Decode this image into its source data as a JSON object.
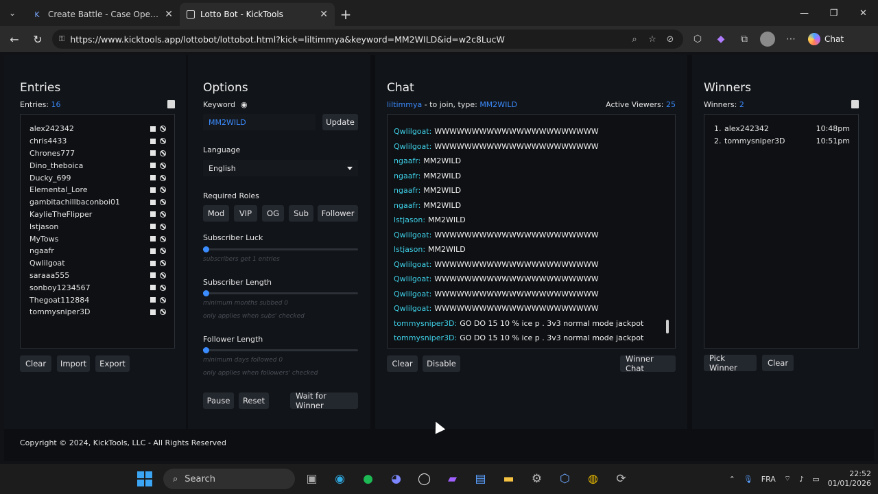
{
  "browser": {
    "tabs": [
      {
        "title": "Create Battle - Case Opening Battle",
        "active": false,
        "icon": "kick-icon"
      },
      {
        "title": "Lotto Bot - KickTools",
        "active": true,
        "icon": "kicktools-icon"
      }
    ],
    "url": "https://www.kicktools.app/lottobot/lottobot.html?kick=liltimmya&keyword=MM2WILD&id=w2c8LucW",
    "copilot_label": "Chat"
  },
  "entries": {
    "title": "Entries",
    "count_label": "Entries:",
    "count": "16",
    "items": [
      "alex242342",
      "chris4433",
      "Chrones777",
      "Dino_theboica",
      "Ducky_699",
      "Elemental_Lore",
      "gambitachillbaconboi01",
      "KaylieTheFlipper",
      "lstjason",
      "MyTows",
      "ngaafr",
      "Qwlilgoat",
      "saraaa555",
      "sonboy1234567",
      "Thegoat112884",
      "tommysniper3D"
    ],
    "buttons": {
      "clear": "Clear",
      "import": "Import",
      "export": "Export"
    }
  },
  "options": {
    "title": "Options",
    "keyword_label": "Keyword",
    "keyword_value": "MM2WILD",
    "update_label": "Update",
    "language_label": "Language",
    "language_value": "English",
    "roles_label": "Required Roles",
    "roles": [
      "Mod",
      "VIP",
      "OG",
      "Sub",
      "Follower"
    ],
    "sub_luck_label": "Subscriber Luck",
    "sub_luck_hint": "subscribers get 1 entries",
    "sub_length_label": "Subscriber Length",
    "sub_length_hint1": "minimum months subbed 0",
    "sub_length_hint2": "only applies when subs' checked",
    "follower_length_label": "Follower Length",
    "follower_length_hint1": "minimum days followed 0",
    "follower_length_hint2": "only applies when followers' checked",
    "pause_label": "Pause",
    "reset_label": "Reset",
    "wait_label": "Wait for Winner"
  },
  "chat": {
    "title": "Chat",
    "channel": "liltimmya",
    "join_text": "- to join, type:",
    "keyword": "MM2WILD",
    "viewers_label": "Active Viewers:",
    "viewers": "25",
    "messages": [
      {
        "user": "Qwlilgoat:",
        "text": "WWWWWWWWWWWWWWWWWWWWWW"
      },
      {
        "user": "Qwlilgoat:",
        "text": "WWWWWWWWWWWWWWWWWWWWWW"
      },
      {
        "user": "ngaafr:",
        "text": "MM2WILD"
      },
      {
        "user": "ngaafr:",
        "text": "MM2WILD"
      },
      {
        "user": "ngaafr:",
        "text": "MM2WILD"
      },
      {
        "user": "ngaafr:",
        "text": "MM2WILD"
      },
      {
        "user": "lstjason:",
        "text": "MM2WILD"
      },
      {
        "user": "Qwlilgoat:",
        "text": "WWWWWWWWWWWWWWWWWWWWWW"
      },
      {
        "user": "lstjason:",
        "text": "MM2WILD"
      },
      {
        "user": "Qwlilgoat:",
        "text": "WWWWWWWWWWWWWWWWWWWWWW"
      },
      {
        "user": "Qwlilgoat:",
        "text": "WWWWWWWWWWWWWWWWWWWWWW"
      },
      {
        "user": "Qwlilgoat:",
        "text": "WWWWWWWWWWWWWWWWWWWWWW"
      },
      {
        "user": "Qwlilgoat:",
        "text": "WWWWWWWWWWWWWWWWWWWWWW"
      },
      {
        "user": "tommysniper3D:",
        "text": "GO DO 15 10 % ice p . 3v3 normal mode jackpot"
      },
      {
        "user": "tommysniper3D:",
        "text": "GO DO 15 10 % ice p . 3v3 normal mode jackpot"
      }
    ],
    "clear_label": "Clear",
    "disable_label": "Disable",
    "winner_chat_label": "Winner Chat"
  },
  "winners": {
    "title": "Winners",
    "count_label": "Winners:",
    "count": "2",
    "items": [
      {
        "num": "1.",
        "name": "alex242342",
        "time": "10:48pm"
      },
      {
        "num": "2.",
        "name": "tommysniper3D",
        "time": "10:51pm"
      }
    ],
    "pick_label": "Pick Winner",
    "clear_label": "Clear"
  },
  "footer": "Copyright © 2024, KickTools, LLC - All Rights Reserved",
  "taskbar": {
    "search_label": "Search",
    "lang": "FRA",
    "time": "22:52",
    "date": "01/01/2026"
  },
  "colors": {
    "accent": "#3b8cff",
    "chat_user": "#3fd0e8",
    "background": "#0c0e11"
  }
}
